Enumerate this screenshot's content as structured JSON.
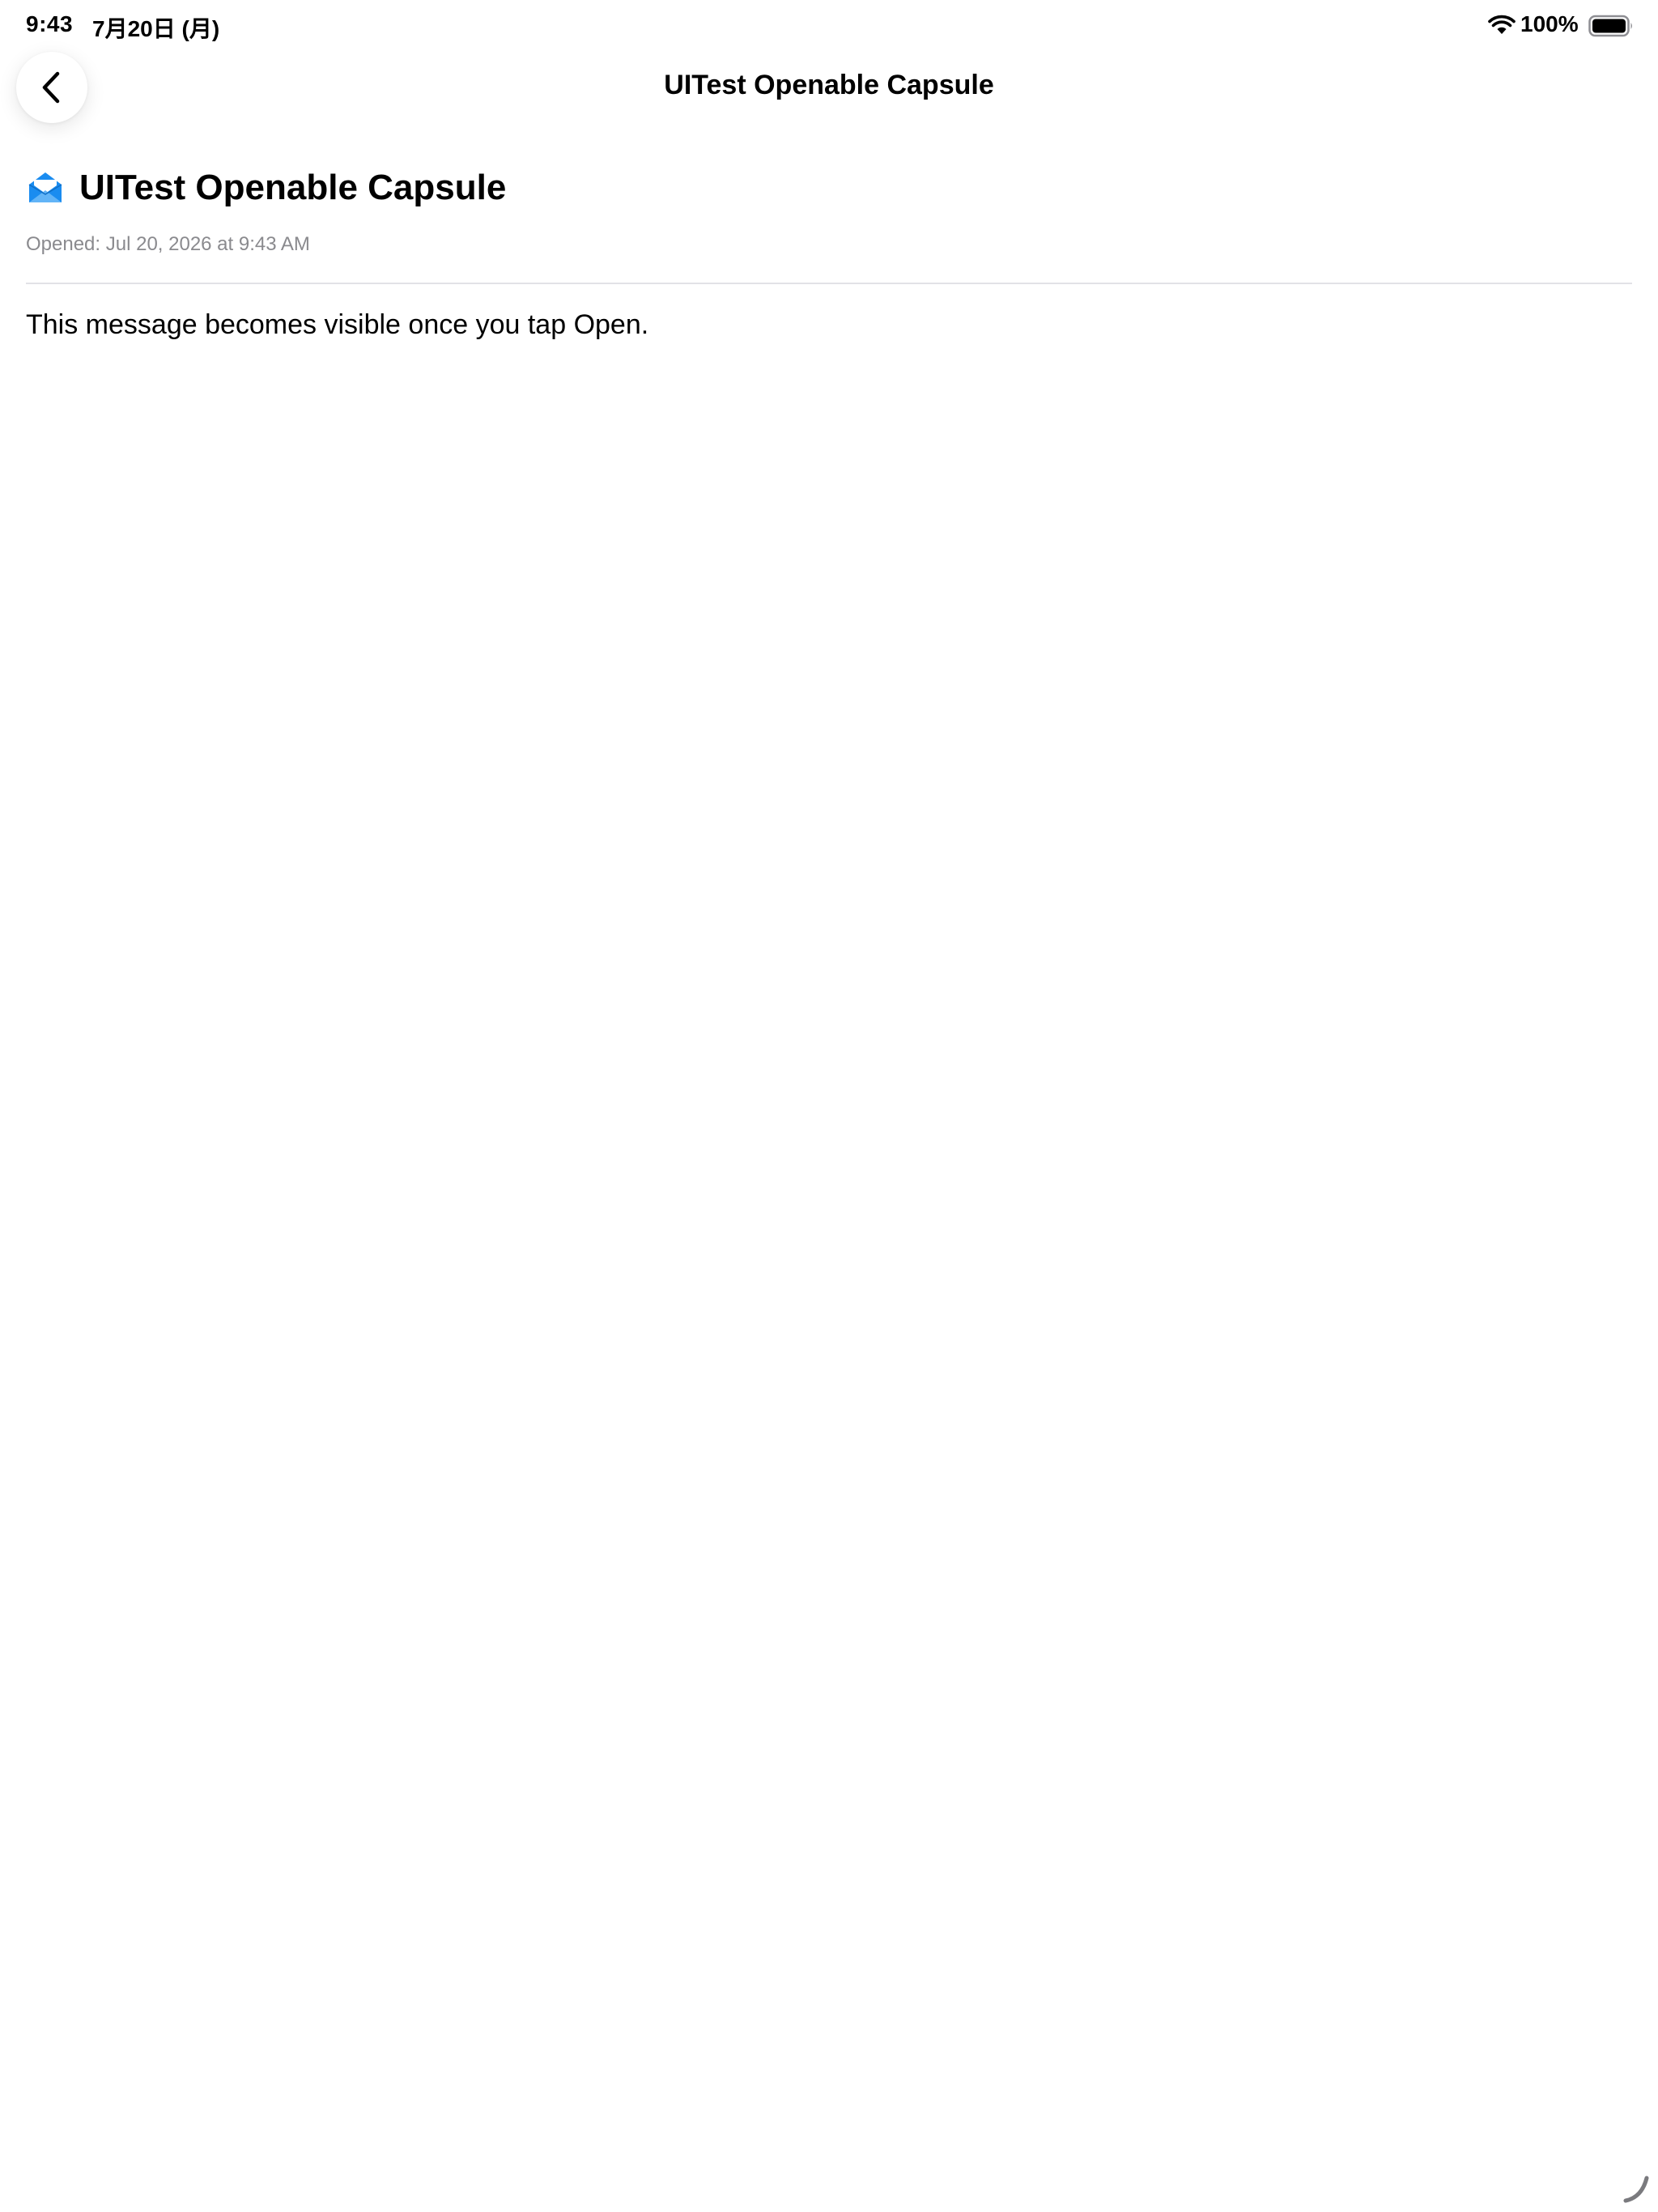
{
  "status_bar": {
    "time": "9:43",
    "date": "7月20日 (月)",
    "battery_percent": "100%",
    "battery_level": 1.0,
    "wifi_icon": "wifi-icon",
    "battery_icon": "battery-icon"
  },
  "nav": {
    "title": "UITest Openable Capsule",
    "back_icon": "chevron-left-icon"
  },
  "capsule": {
    "icon": "open-envelope-icon",
    "title": "UITest Openable Capsule",
    "opened_label": "Opened: Jul 20, 2026 at 9:43 AM",
    "message": "This message becomes visible once you tap Open."
  },
  "colors": {
    "accent": "#1a8cf0",
    "secondary_text": "#8a8a8e",
    "divider": "#e2e2e6"
  }
}
